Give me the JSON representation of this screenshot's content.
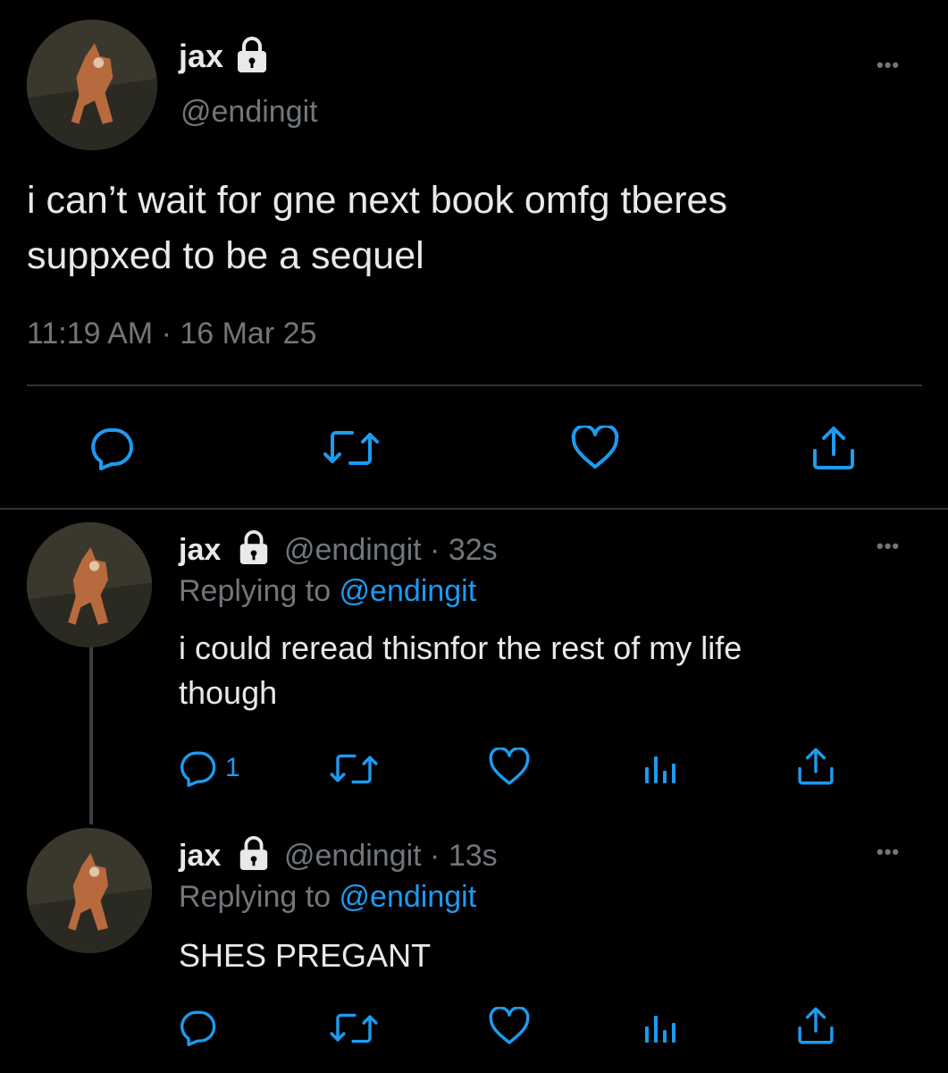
{
  "main_tweet": {
    "display_name": "jax",
    "handle": "@endingit",
    "text_line1": "i can’t wait for gne next book omfg tberes",
    "text_line2": "suppxed to be a sequel",
    "timestamp": "11:19 AM · 16 Mar 25"
  },
  "replies": [
    {
      "display_name": "jax",
      "handle_time": "@endingit · 32s",
      "replying_label": "Replying to ",
      "replying_handle": "@endingit",
      "text_line1": "i could reread thisnfor the rest of my life",
      "text_line2": "though",
      "reply_count": "1"
    },
    {
      "display_name": "jax",
      "handle_time": "@endingit · 13s",
      "replying_label": "Replying to ",
      "replying_handle": "@endingit",
      "text_line1": "SHES PREGANT",
      "reply_count": ""
    }
  ],
  "more_glyph": "•••",
  "icons": [
    "reply-icon",
    "retweet-icon",
    "like-icon",
    "views-icon",
    "share-icon",
    "lock-icon",
    "more-icon"
  ],
  "colors": {
    "background": "#000000",
    "text": "#e7e9ea",
    "muted": "#71767b",
    "link": "#1d9bf0",
    "divider": "#2f3336"
  }
}
